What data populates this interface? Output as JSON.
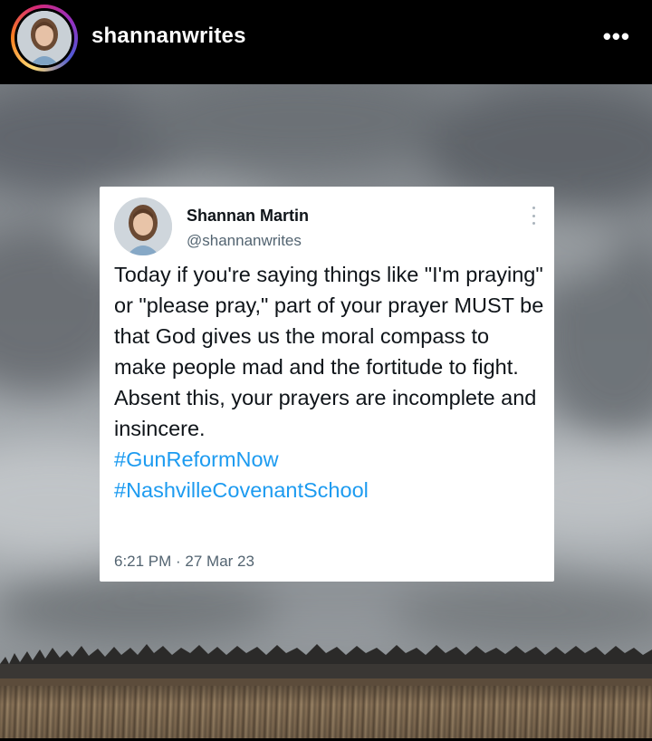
{
  "header": {
    "username": "shannanwrites",
    "more_label": "•••"
  },
  "tweet": {
    "display_name": "Shannan Martin",
    "handle": "@shannanwrites",
    "text": "Today if you're saying things like \"I'm praying\" or \"please pray,\" part of your prayer MUST be that God gives us the moral compass to make people mad and the fortitude to fight. Absent this, your prayers are incomplete and insincere.",
    "hashtags": [
      "#GunReformNow",
      "#NashvilleCovenantSchool"
    ],
    "timestamp": "6:21 PM · 27 Mar 23"
  },
  "icons": {
    "more": "more-horizontal-icon",
    "tweet_menu": "more-vertical-icon"
  },
  "colors": {
    "header_bg": "#000000",
    "link": "#1d9bf0",
    "secondary_text": "#536471",
    "primary_text": "#0f1419"
  }
}
